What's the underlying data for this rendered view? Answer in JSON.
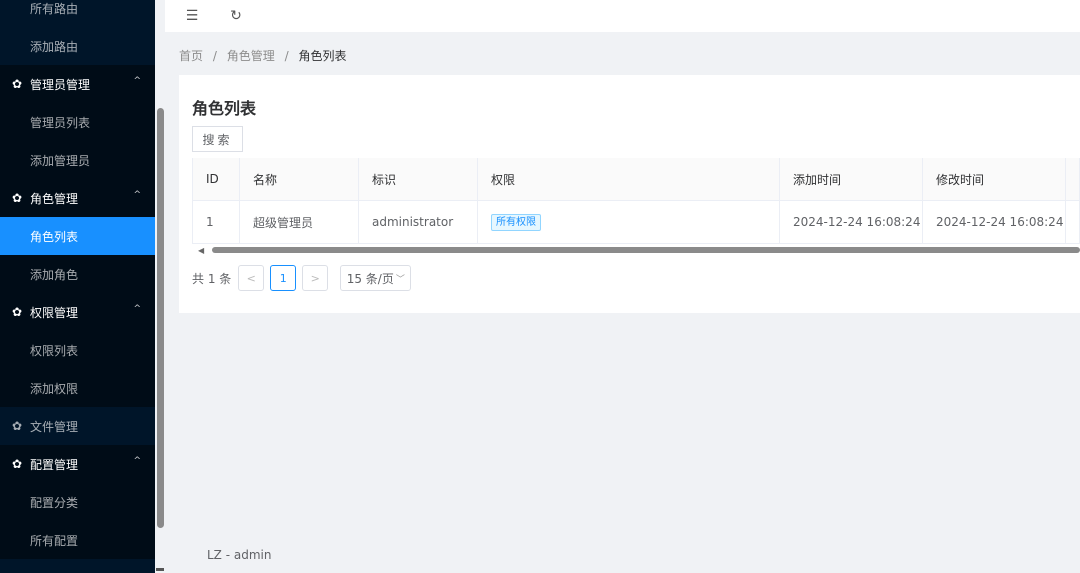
{
  "sidebar": {
    "top_items": [
      "所有路由",
      "添加路由"
    ],
    "groups": [
      {
        "title": "管理员管理",
        "arrow": "^",
        "items": [
          "管理员列表",
          "添加管理员"
        ]
      },
      {
        "title": "角色管理",
        "arrow": "^",
        "items": [
          "角色列表",
          "添加角色"
        ],
        "active_item": "角色列表"
      },
      {
        "title": "权限管理",
        "arrow": "^",
        "items": [
          "权限列表",
          "添加权限"
        ]
      },
      {
        "title": "文件管理",
        "collapsed": true
      },
      {
        "title": "配置管理",
        "arrow": "^",
        "items": [
          "配置分类",
          "所有配置"
        ]
      }
    ],
    "icon": "gear-icon",
    "active_color": "#1890ff",
    "bg_color": "#001529"
  },
  "header": {
    "collapse_icon": "☰",
    "refresh_icon": "↻"
  },
  "breadcrumb": {
    "items": [
      "首页",
      "角色管理",
      "角色列表"
    ],
    "separator": "/"
  },
  "page": {
    "title": "角色列表",
    "search_label": "搜索"
  },
  "table": {
    "columns": [
      "ID",
      "名称",
      "标识",
      "权限",
      "添加时间",
      "修改时间"
    ],
    "rows": [
      {
        "id": "1",
        "name": "超级管理员",
        "mark": "administrator",
        "permission": "所有权限",
        "created": "2024-12-24 16:08:24",
        "updated": "2024-12-24 16:08:24"
      }
    ]
  },
  "pagination": {
    "total": "共 1 条",
    "prev": "<",
    "current": "1",
    "next": ">",
    "page_size": "15 条/页"
  },
  "footer": {
    "text": "LZ - admin"
  }
}
